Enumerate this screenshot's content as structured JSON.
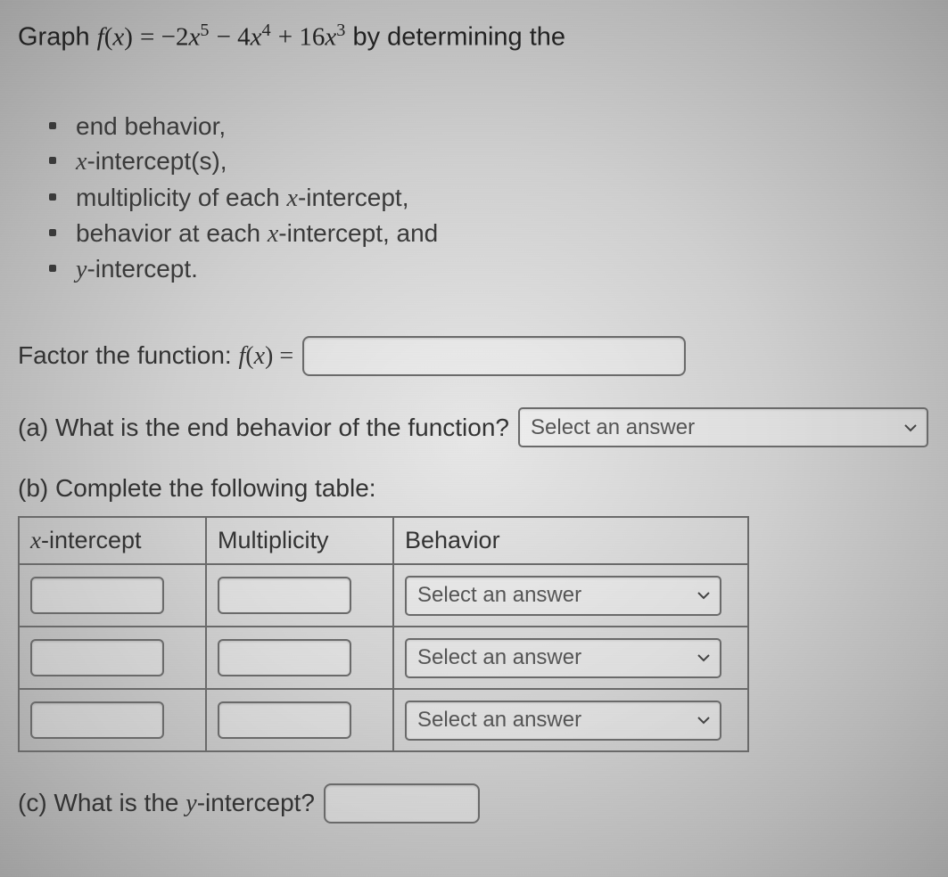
{
  "intro": {
    "prefix": "Graph ",
    "func_lhs_f": "f",
    "func_lhs_x": "x",
    "equals": " = ",
    "term1_coef": "−2",
    "term1_var": "x",
    "term1_exp": "5",
    "minus": " − ",
    "term2_coef": "4",
    "term2_var": "x",
    "term2_exp": "4",
    "plus": " + ",
    "term3_coef": "16",
    "term3_var": "x",
    "term3_exp": "3",
    "suffix": " by determining the"
  },
  "bullets": {
    "b1": "end behavior,",
    "b2_pre": "",
    "b2_var": "x",
    "b2_post": "-intercept(s),",
    "b3_pre": "multiplicity of each ",
    "b3_var": "x",
    "b3_post": "-intercept,",
    "b4_pre": "behavior at each ",
    "b4_var": "x",
    "b4_post": "-intercept, and",
    "b5_var": "y",
    "b5_post": "-intercept."
  },
  "factor": {
    "label": "Factor the function: ",
    "f": "f",
    "x": "x",
    "eq": " ="
  },
  "qa": {
    "a_label": "(a) What is the end behavior of the function?",
    "b_label": "(b) Complete the following table:",
    "c_label_pre": "(c) What is the ",
    "c_var": "y",
    "c_label_post": "-intercept?"
  },
  "table": {
    "h1_var": "x",
    "h1_post": "-intercept",
    "h2": "Multiplicity",
    "h3": "Behavior"
  },
  "select": {
    "placeholder": "Select an answer"
  }
}
